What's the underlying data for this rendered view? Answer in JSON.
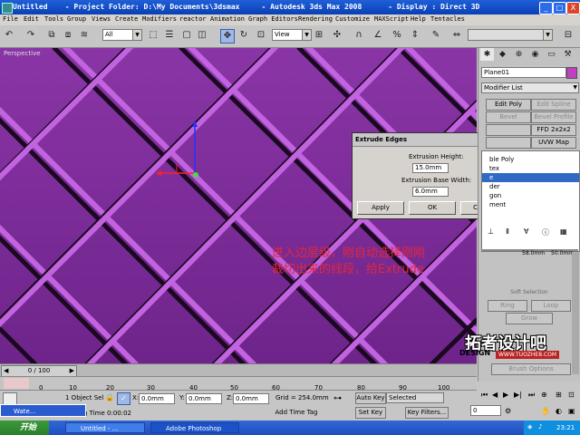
{
  "window": {
    "title": "Untitled    - Project Folder: D:\\My Documents\\3dsmax     - Autodesk 3ds Max 2008      - Display : Direct 3D",
    "minimize": "_",
    "maximize": "□",
    "close": "X"
  },
  "menu": {
    "items": [
      "File",
      "Edit",
      "Tools",
      "Group",
      "Views",
      "Create",
      "Modifiers",
      "reactor",
      "Animation",
      "Graph Editors",
      "Rendering",
      "Customize",
      "MAXScript",
      "Help",
      "Tentacles"
    ]
  },
  "toolbar": {
    "selection_filter": "All",
    "reference_coord": "View"
  },
  "viewport": {
    "label": "Perspective",
    "color": "#7a2a95"
  },
  "dialog": {
    "title": "Extrude Edges",
    "close": "✕",
    "height_label": "Extrusion Height:",
    "height_value": "15.0mm",
    "width_label": "Extrusion Base Width:",
    "width_value": "6.0mm",
    "apply": "Apply",
    "ok": "OK",
    "cancel": "Cancel"
  },
  "command_panel": {
    "object_name": "Plane01",
    "object_color": "#c040c0",
    "modifier_list": "Modifier List",
    "buttons": {
      "edit_poly": "Edit Poly",
      "edit_spline": "Edit Spline",
      "bevel": "Bevel",
      "bevel_profile": "Bevel Profile",
      "ffd": "FFD 2x2x2",
      "uvw_map": "UVW Map"
    },
    "stack": [
      {
        "label": "ble Poly",
        "selected": false
      },
      {
        "label": "tex",
        "selected": false
      },
      {
        "label": "e",
        "selected": true
      },
      {
        "label": "der",
        "selected": false
      },
      {
        "label": "gon",
        "selected": false
      },
      {
        "label": "ment",
        "selected": false
      }
    ],
    "values": [
      "58.0mm",
      "50.0mm"
    ],
    "soft_selection": "Soft Selection",
    "ring": "Ring",
    "loop": "Loop",
    "shrink_grow": "Grow",
    "paint": "Brush Options"
  },
  "timeline": {
    "frame_display": "0 / 100",
    "ticks": [
      "0",
      "10",
      "20",
      "30",
      "40",
      "50",
      "60",
      "70",
      "80",
      "90",
      "100"
    ]
  },
  "status": {
    "selected_count": "1 Object Sel",
    "x_label": "X:",
    "x_value": "0.0mm",
    "y_label": "Y:",
    "y_value": "0.0mm",
    "z_label": "Z:",
    "z_value": "0.0mm",
    "grid": "Grid = 254.0mm",
    "auto_key": "Auto Key",
    "key_filter_dropdown": "Selected",
    "set_key": "Set Key",
    "key_filters": "Key Filters...",
    "time_tag": "Add Time Tag",
    "rendering_time": "g Time 0:00:02",
    "frame": "0"
  },
  "annotation": {
    "line1": "进入边层级，刚自动选择刚刚",
    "line2": "裁切出来的线段，给Extrude"
  },
  "watermark": {
    "cn": "拓者设计吧",
    "en": "DESIGN",
    "url": "WWW.TUOZHE8.COM"
  },
  "taskbar": {
    "start": "开始",
    "ime": "Wate...",
    "tasks": [
      "Untitled     - ...",
      "Adobe Photoshop"
    ],
    "clock": "23:21"
  }
}
